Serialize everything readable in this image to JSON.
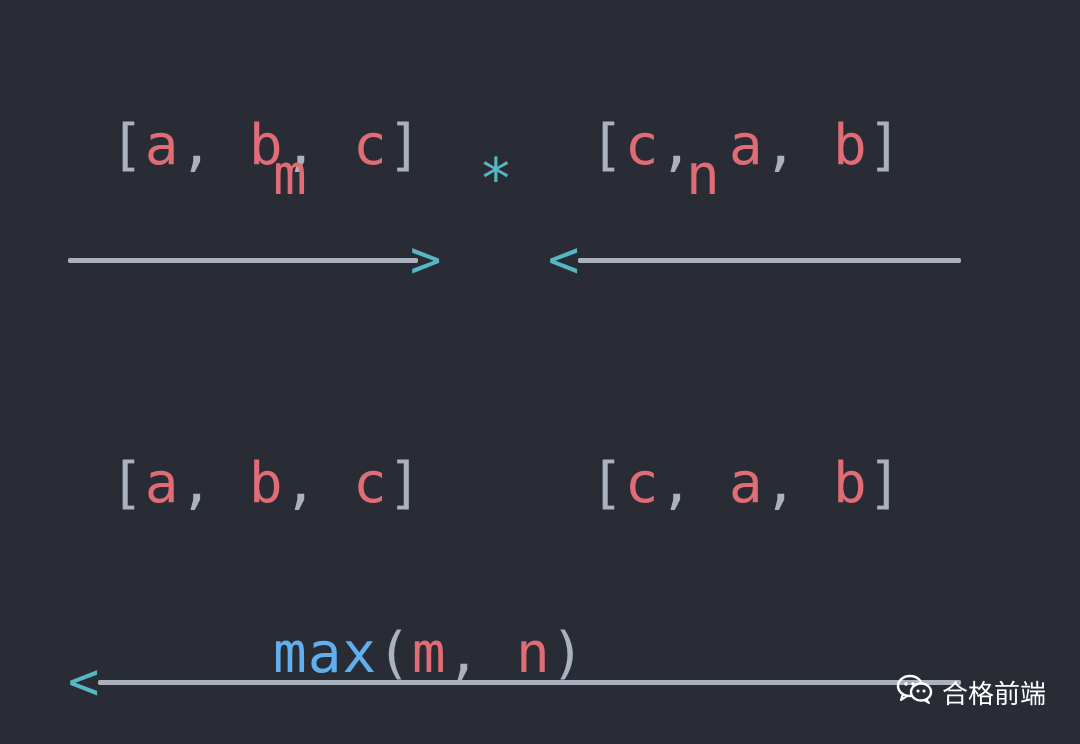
{
  "row1": {
    "left_list": {
      "open": "[",
      "items": [
        "a",
        "b",
        "c"
      ],
      "sep": ",",
      "close": "]"
    },
    "right_list": {
      "open": "[",
      "items": [
        "c",
        "a",
        "b"
      ],
      "sep": ",",
      "close": "]"
    }
  },
  "row2": {
    "left_var": "m",
    "operator": "*",
    "right_var": "n"
  },
  "arrows_top": {
    "right_head": ">",
    "left_head": "<"
  },
  "row3": {
    "left_list": {
      "open": "[",
      "items": [
        "a",
        "b",
        "c"
      ],
      "sep": ",",
      "close": "]"
    },
    "right_list": {
      "open": "[",
      "items": [
        "c",
        "a",
        "b"
      ],
      "sep": ",",
      "close": "]"
    }
  },
  "expr": {
    "fn": "max",
    "open": "(",
    "arg1": "m",
    "sep": ",",
    "arg2": "n",
    "close": ")"
  },
  "arrow_bottom": {
    "head": "<"
  },
  "watermark": {
    "icon": "wechat-icon",
    "text": "合格前端"
  },
  "colors": {
    "background": "#292c35",
    "punctuation": "#abb2bf",
    "variable": "#e06c75",
    "operator": "#56b6c2",
    "function": "#61afef"
  }
}
